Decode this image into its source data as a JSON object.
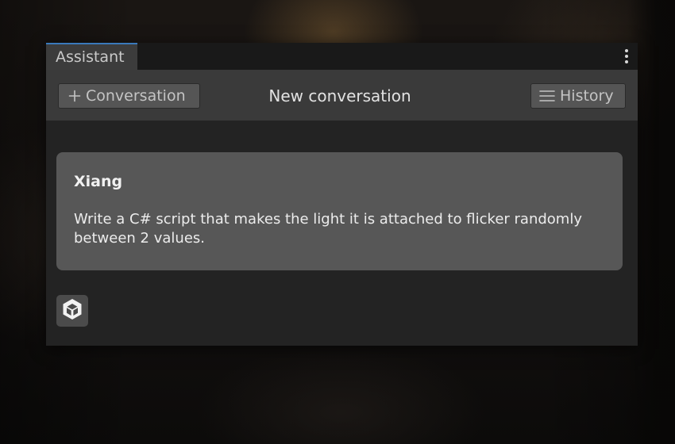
{
  "window": {
    "tab_label": "Assistant",
    "menu_icon": "kebab-menu-icon"
  },
  "toolbar": {
    "new_conversation_label": "Conversation",
    "new_conversation_icon": "plus-icon",
    "title": "New conversation",
    "history_label": "History",
    "history_icon": "hamburger-icon"
  },
  "conversation": {
    "messages": [
      {
        "author": "Xiang",
        "text": "Write a C# script that makes the light it is attached to flicker randomly between 2 values."
      }
    ],
    "assistant_icon": "unity-logo-icon"
  },
  "colors": {
    "panel": "#232323",
    "toolbar": "#3a3a3a",
    "card": "#575757",
    "tab_accent": "#3a79bb"
  }
}
